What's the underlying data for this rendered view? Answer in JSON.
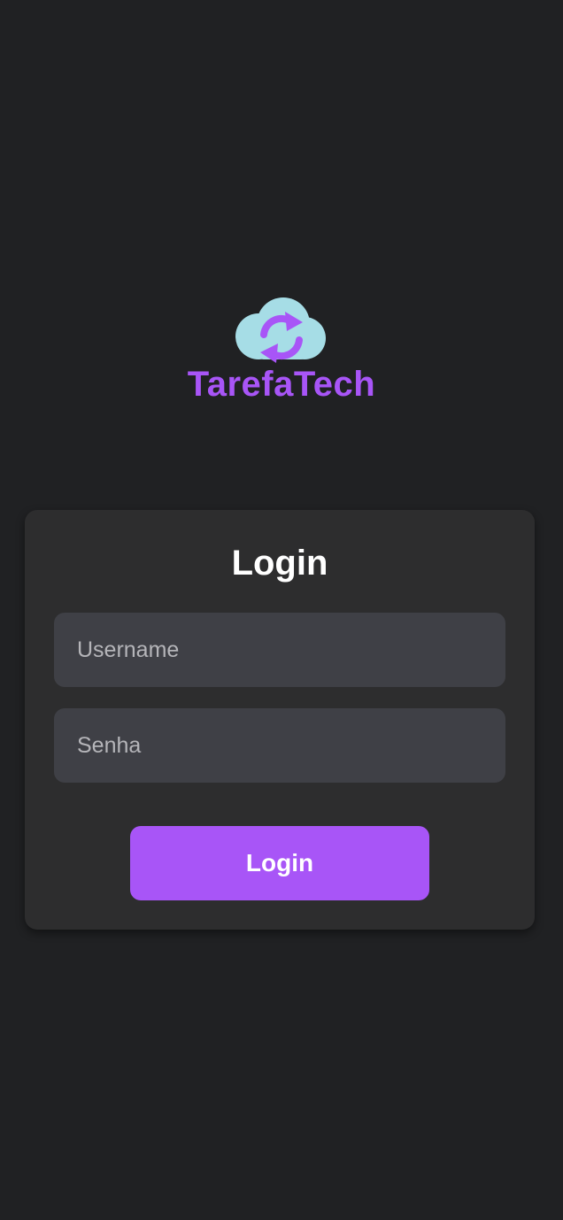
{
  "brand": {
    "name": "TarefaTech",
    "icon": "cloud-sync-icon",
    "color": "#a855f7",
    "cloud_color": "#a6dde6"
  },
  "login_form": {
    "title": "Login",
    "username_placeholder": "Username",
    "password_placeholder": "Senha",
    "submit_label": "Login"
  },
  "colors": {
    "background": "#202123",
    "card": "#2d2d2e",
    "input": "#3f4046",
    "accent": "#a855f7"
  }
}
